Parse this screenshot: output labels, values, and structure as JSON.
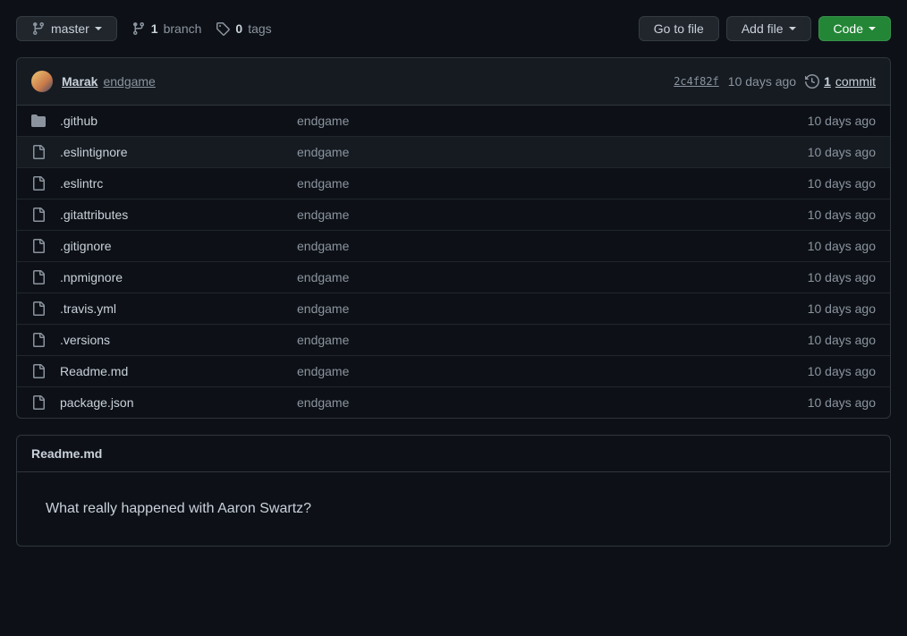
{
  "branch": {
    "name": "master"
  },
  "branches": {
    "count": "1",
    "label": "branch"
  },
  "tags": {
    "count": "0",
    "label": "tags"
  },
  "actions": {
    "goToFile": "Go to file",
    "addFile": "Add file",
    "code": "Code"
  },
  "latestCommit": {
    "author": "Marak",
    "message": "endgame",
    "hash": "2c4f82f",
    "date": "10 days ago",
    "commitCount": "1",
    "commitLabel": "commit"
  },
  "files": [
    {
      "type": "dir",
      "name": ".github",
      "message": "endgame",
      "age": "10 days ago"
    },
    {
      "type": "file",
      "name": ".eslintignore",
      "message": "endgame",
      "age": "10 days ago",
      "hovered": true
    },
    {
      "type": "file",
      "name": ".eslintrc",
      "message": "endgame",
      "age": "10 days ago"
    },
    {
      "type": "file",
      "name": ".gitattributes",
      "message": "endgame",
      "age": "10 days ago"
    },
    {
      "type": "file",
      "name": ".gitignore",
      "message": "endgame",
      "age": "10 days ago"
    },
    {
      "type": "file",
      "name": ".npmignore",
      "message": "endgame",
      "age": "10 days ago"
    },
    {
      "type": "file",
      "name": ".travis.yml",
      "message": "endgame",
      "age": "10 days ago"
    },
    {
      "type": "file",
      "name": ".versions",
      "message": "endgame",
      "age": "10 days ago"
    },
    {
      "type": "file",
      "name": "Readme.md",
      "message": "endgame",
      "age": "10 days ago"
    },
    {
      "type": "file",
      "name": "package.json",
      "message": "endgame",
      "age": "10 days ago"
    }
  ],
  "readme": {
    "filename": "Readme.md",
    "body": "What really happened with Aaron Swartz?"
  }
}
